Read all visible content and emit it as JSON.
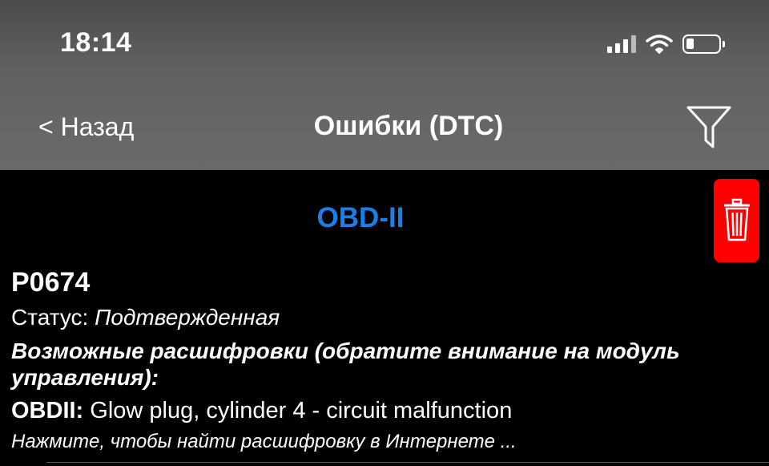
{
  "status_bar": {
    "time": "18:14"
  },
  "nav": {
    "back_label": "< Назад",
    "title": "Ошибки (DTC)"
  },
  "section": {
    "title": "OBD-II"
  },
  "error": {
    "code": "P0674",
    "status_label": "Статус: ",
    "status_value": "Подтвержденная",
    "desc_title": "Возможные расшифровки (обратите внимание на модуль управления):",
    "obd_label": "OBDII:",
    "obd_text": " Glow plug, cylinder 4 - circuit malfunction",
    "search_link": "Нажмите, чтобы найти расшифровку в Интернете ..."
  },
  "colors": {
    "accent": "#1a7fe6",
    "delete": "#ff0000"
  },
  "icons": [
    "signal-icon",
    "wifi-icon",
    "battery-icon",
    "filter-icon",
    "trash-icon"
  ]
}
